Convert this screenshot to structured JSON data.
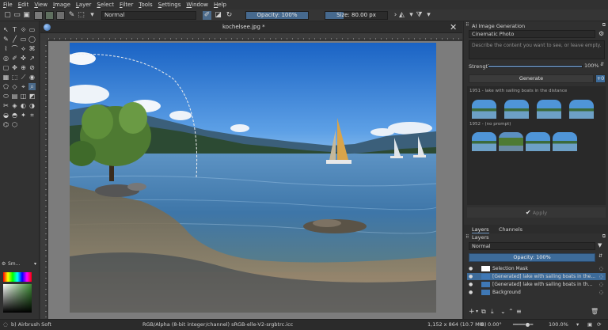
{
  "menubar": [
    "File",
    "Edit",
    "View",
    "Image",
    "Layer",
    "Select",
    "Filter",
    "Tools",
    "Settings",
    "Window",
    "Help"
  ],
  "toolbar": {
    "blend_mode": "Normal",
    "opacity_label": "Opacity: 100%",
    "opacity_value": 1.0,
    "size_label": "Size: 80.00 px",
    "size_fill": 0.3
  },
  "document": {
    "tab_title": "kochelsee.jpg *"
  },
  "ai_panel": {
    "title": "AI Image Generation",
    "style_preset": "Cinematic Photo",
    "prompt_placeholder": "Describe the content you want to see, or leave empty.",
    "strength_label": "Strength",
    "strength_value_text": "100%",
    "strength_value": 1.0,
    "generate_label": "Generate",
    "generate_count": "+0",
    "history_1_caption": "1951 - lake with sailing boats in the distance",
    "history_2_caption": "1952 - (no prompt)",
    "apply_label": "Apply"
  },
  "layers_panel": {
    "tab_layers": "Layers",
    "tab_channels": "Channels",
    "header": "Layers",
    "blend_mode": "Normal",
    "opacity_label": "Opacity: 100%",
    "layers": [
      {
        "name": "Selection Mask",
        "selected": false
      },
      {
        "name": "[Generated] lake with sailing boats in the...",
        "selected": true
      },
      {
        "name": "[Generated] lake with sailing boats in th...",
        "selected": false
      },
      {
        "name": "Background",
        "selected": false
      }
    ]
  },
  "brush_panel": {
    "label": "Sm..."
  },
  "statusbar": {
    "brush": "b) Airbrush Soft",
    "color_info": "RGB/Alpha (8-bit integer/channel)  sRGB-elle-V2-srgbtrc.icc",
    "image_size": "1,152 x 864 (10.7 MiB)",
    "rotation": "0.00°",
    "zoom": "100.0%"
  },
  "colors": {
    "accent": "#46698e",
    "selected_row": "#3d6b99",
    "sky_top": "#1e6cc8",
    "water": "#3f79ad"
  }
}
